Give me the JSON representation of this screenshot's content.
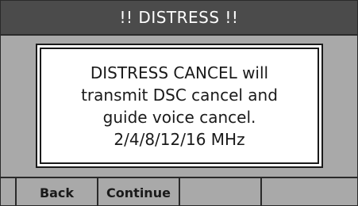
{
  "title": "!! DISTRESS !!",
  "dialog": {
    "lines": [
      "DISTRESS CANCEL will",
      "transmit DSC cancel and",
      "guide voice cancel.",
      "2/4/8/12/16 MHz"
    ]
  },
  "softkeys": [
    "Back",
    "Continue",
    "",
    ""
  ],
  "colors": {
    "title_bar": "#4b4b4b",
    "background": "#a9a9a9",
    "dialog": "#ffffff"
  }
}
